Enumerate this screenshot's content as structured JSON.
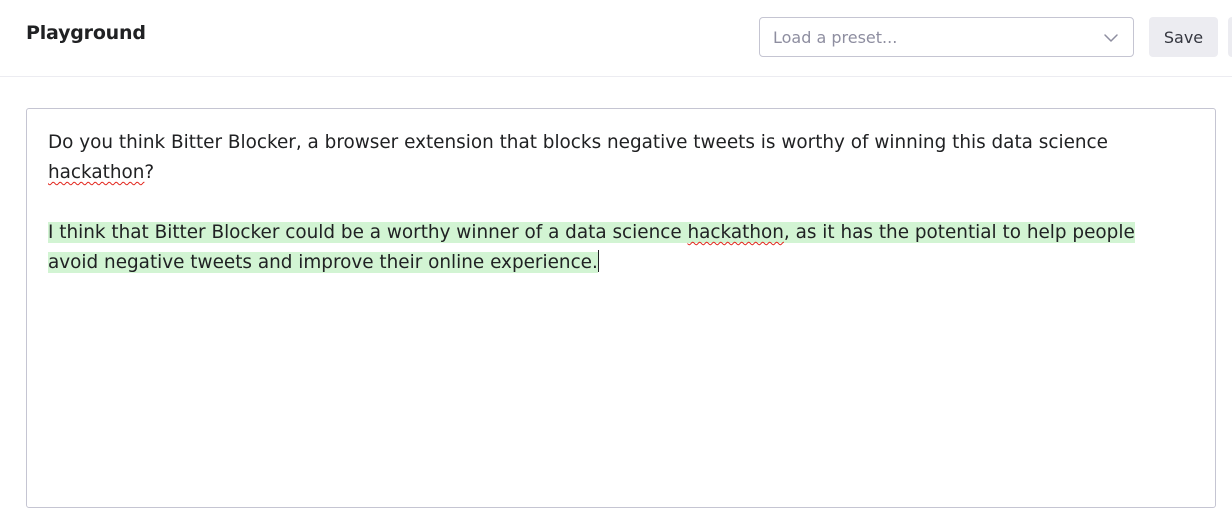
{
  "header": {
    "title": "Playground",
    "preset_placeholder": "Load a preset...",
    "save_label": "Save"
  },
  "editor": {
    "prompt_before": "Do you think Bitter Blocker, a browser extension that blocks negative tweets is worthy of winning this data science ",
    "prompt_misspelled": "hackathon",
    "prompt_after": "?",
    "completion_before": "I think that Bitter Blocker could be a worthy winner of a data science ",
    "completion_misspelled": "hackathon",
    "completion_after": ", as it has the potential to help people avoid negative tweets and improve their online experience."
  },
  "colors": {
    "completion_highlight": "#d2f4d3",
    "spellcheck_underline": "#e2231a",
    "border": "#c5c5d2",
    "button_bg": "#ececf1"
  },
  "icons": {
    "preset_dropdown": "chevron-down-icon"
  }
}
